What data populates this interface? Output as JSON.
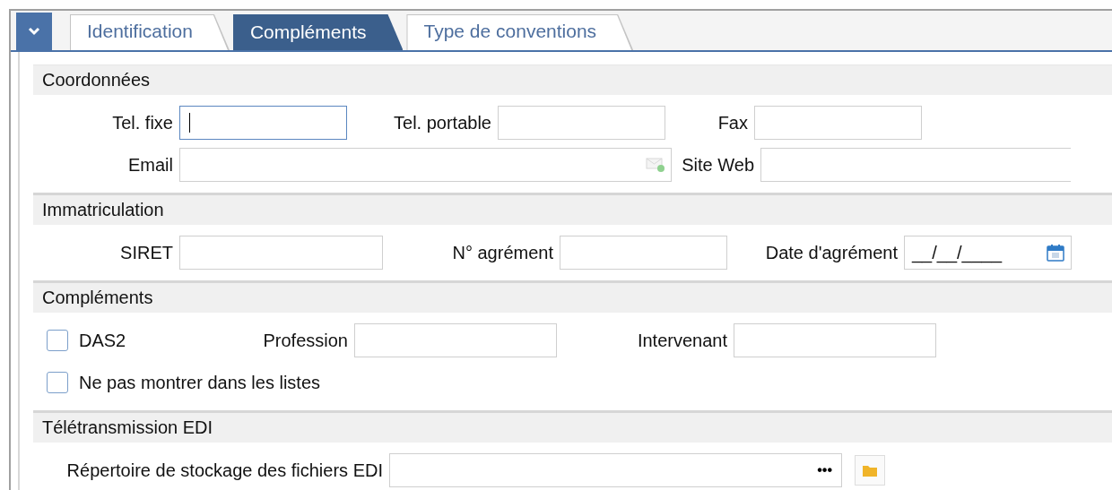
{
  "tabs": [
    {
      "label": "Identification",
      "selected": false
    },
    {
      "label": "Compléments",
      "selected": true
    },
    {
      "label": "Type de conventions",
      "selected": false
    }
  ],
  "sections": [
    {
      "title": "Coordonnées",
      "fields": [
        {
          "kind": "text",
          "label": "Tel. fixe",
          "focused": true
        },
        {
          "kind": "text",
          "label": "Tel. portable",
          "focused": false
        },
        {
          "kind": "text",
          "label": "Fax",
          "focused": false
        },
        {
          "kind": "email",
          "label": "Email",
          "focused": false
        },
        {
          "kind": "text",
          "label": "Site Web",
          "focused": false
        }
      ]
    },
    {
      "title": "Immatriculation",
      "fields": [
        {
          "kind": "text",
          "label": "SIRET",
          "focused": false
        },
        {
          "kind": "text",
          "label": "N° agrément",
          "focused": false
        },
        {
          "kind": "date",
          "label": "Date d'agrément",
          "value": "__/__/____",
          "focused": false
        }
      ]
    },
    {
      "title": "Compléments",
      "fields": [
        {
          "kind": "checkbox",
          "label": "DAS2",
          "checked": false
        },
        {
          "kind": "text",
          "label": "Profession",
          "focused": false
        },
        {
          "kind": "text",
          "label": "Intervenant",
          "focused": false
        },
        {
          "kind": "checkbox",
          "label": "Ne pas montrer dans les listes",
          "checked": false
        }
      ]
    },
    {
      "title": "Télétransmission EDI",
      "fields": [
        {
          "kind": "path",
          "label": "Répertoire de stockage des fichiers EDI",
          "button": "•••",
          "focused": false
        }
      ]
    }
  ]
}
